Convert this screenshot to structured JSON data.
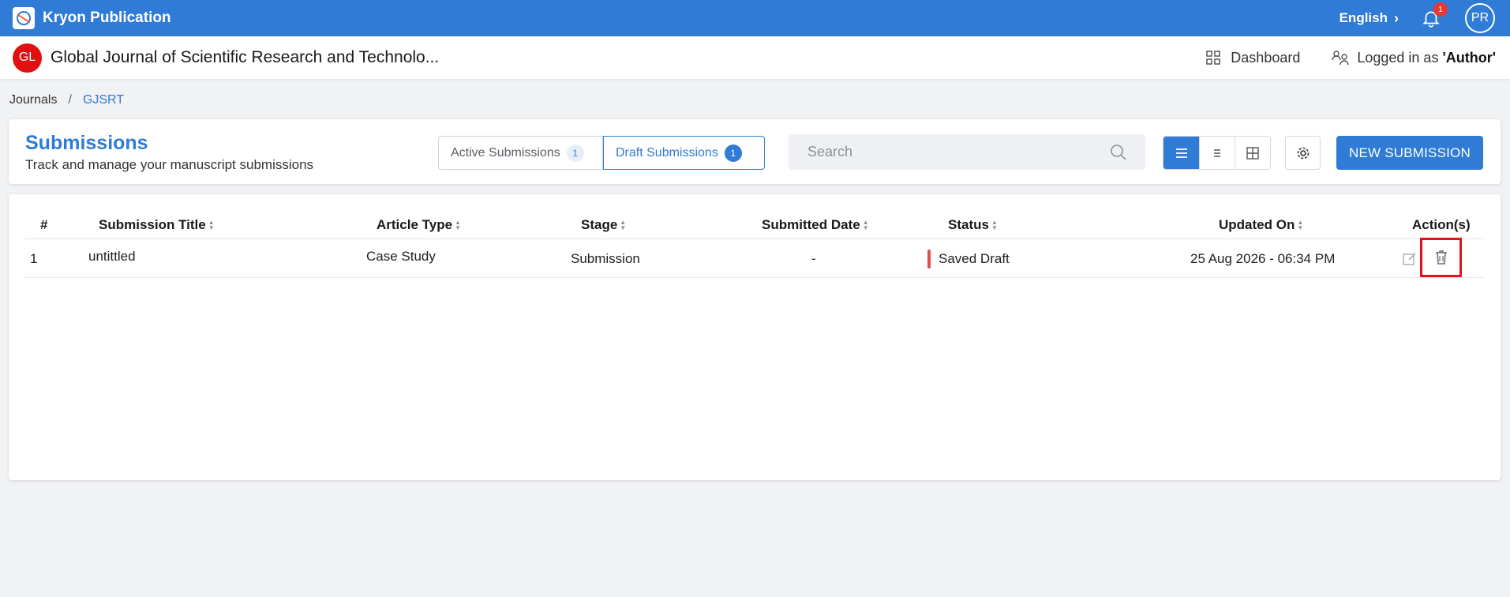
{
  "app": {
    "brand": "Kryon Publication",
    "language": "English",
    "notifications": "1",
    "user_initials": "PR"
  },
  "journal": {
    "badge": "GL",
    "title": "Global Journal of Scientific Research and Technolo...",
    "dashboard_label": "Dashboard",
    "logged_prefix": "Logged in as ",
    "logged_role": "'Author'"
  },
  "breadcrumb": {
    "root": "Journals",
    "separator": "/",
    "current": "GJSRT"
  },
  "header": {
    "title": "Submissions",
    "subtitle": "Track and manage your manuscript submissions",
    "tabs": [
      {
        "label": "Active Submissions",
        "count": "1"
      },
      {
        "label": "Draft Submissions",
        "count": "1"
      }
    ],
    "search_placeholder": "Search",
    "new_button": "NEW SUBMISSION"
  },
  "table": {
    "columns": [
      "#",
      "Submission Title",
      "Article Type",
      "Stage",
      "Submitted Date",
      "Status",
      "Updated On",
      "Action(s)"
    ],
    "rows": [
      {
        "num": "1",
        "title": "untittled",
        "article_type": "Case Study",
        "stage": "Submission",
        "submitted": "-",
        "status": "Saved Draft",
        "updated": "25 Aug 2026 - 06:34 PM"
      }
    ]
  },
  "colors": {
    "primary": "#2f7bd5",
    "status_draft": "#d9534f",
    "highlight": "#e0131a",
    "journal_badge": "#e10f0f"
  }
}
